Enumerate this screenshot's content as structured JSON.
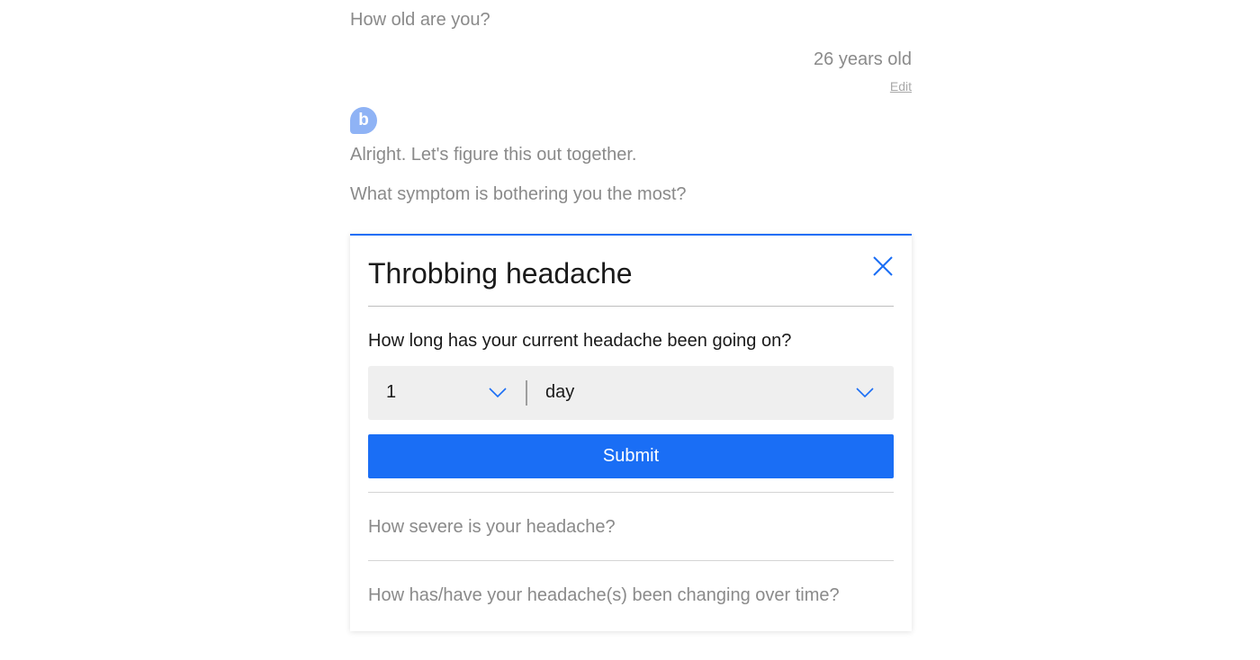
{
  "chat": {
    "age_question": "How old are you?",
    "age_answer": "26 years old",
    "edit_label": "Edit",
    "avatar_letter": "b",
    "message_1": "Alright. Let's figure this out together.",
    "message_2": "What symptom is bothering you the most?"
  },
  "card": {
    "title": "Throbbing headache",
    "question": "How long has your current headache been going on?",
    "duration_value": "1",
    "duration_unit": "day",
    "submit_label": "Submit",
    "next_questions": [
      "How severe is your headache?",
      "How has/have your headache(s) been changing over time?"
    ]
  },
  "colors": {
    "accent": "#1a6ef5",
    "avatar": "#8fb3f5",
    "muted_text": "#8a8a8a"
  },
  "icons": {
    "close": "close-icon",
    "dropdown": "chevron-down-icon"
  }
}
